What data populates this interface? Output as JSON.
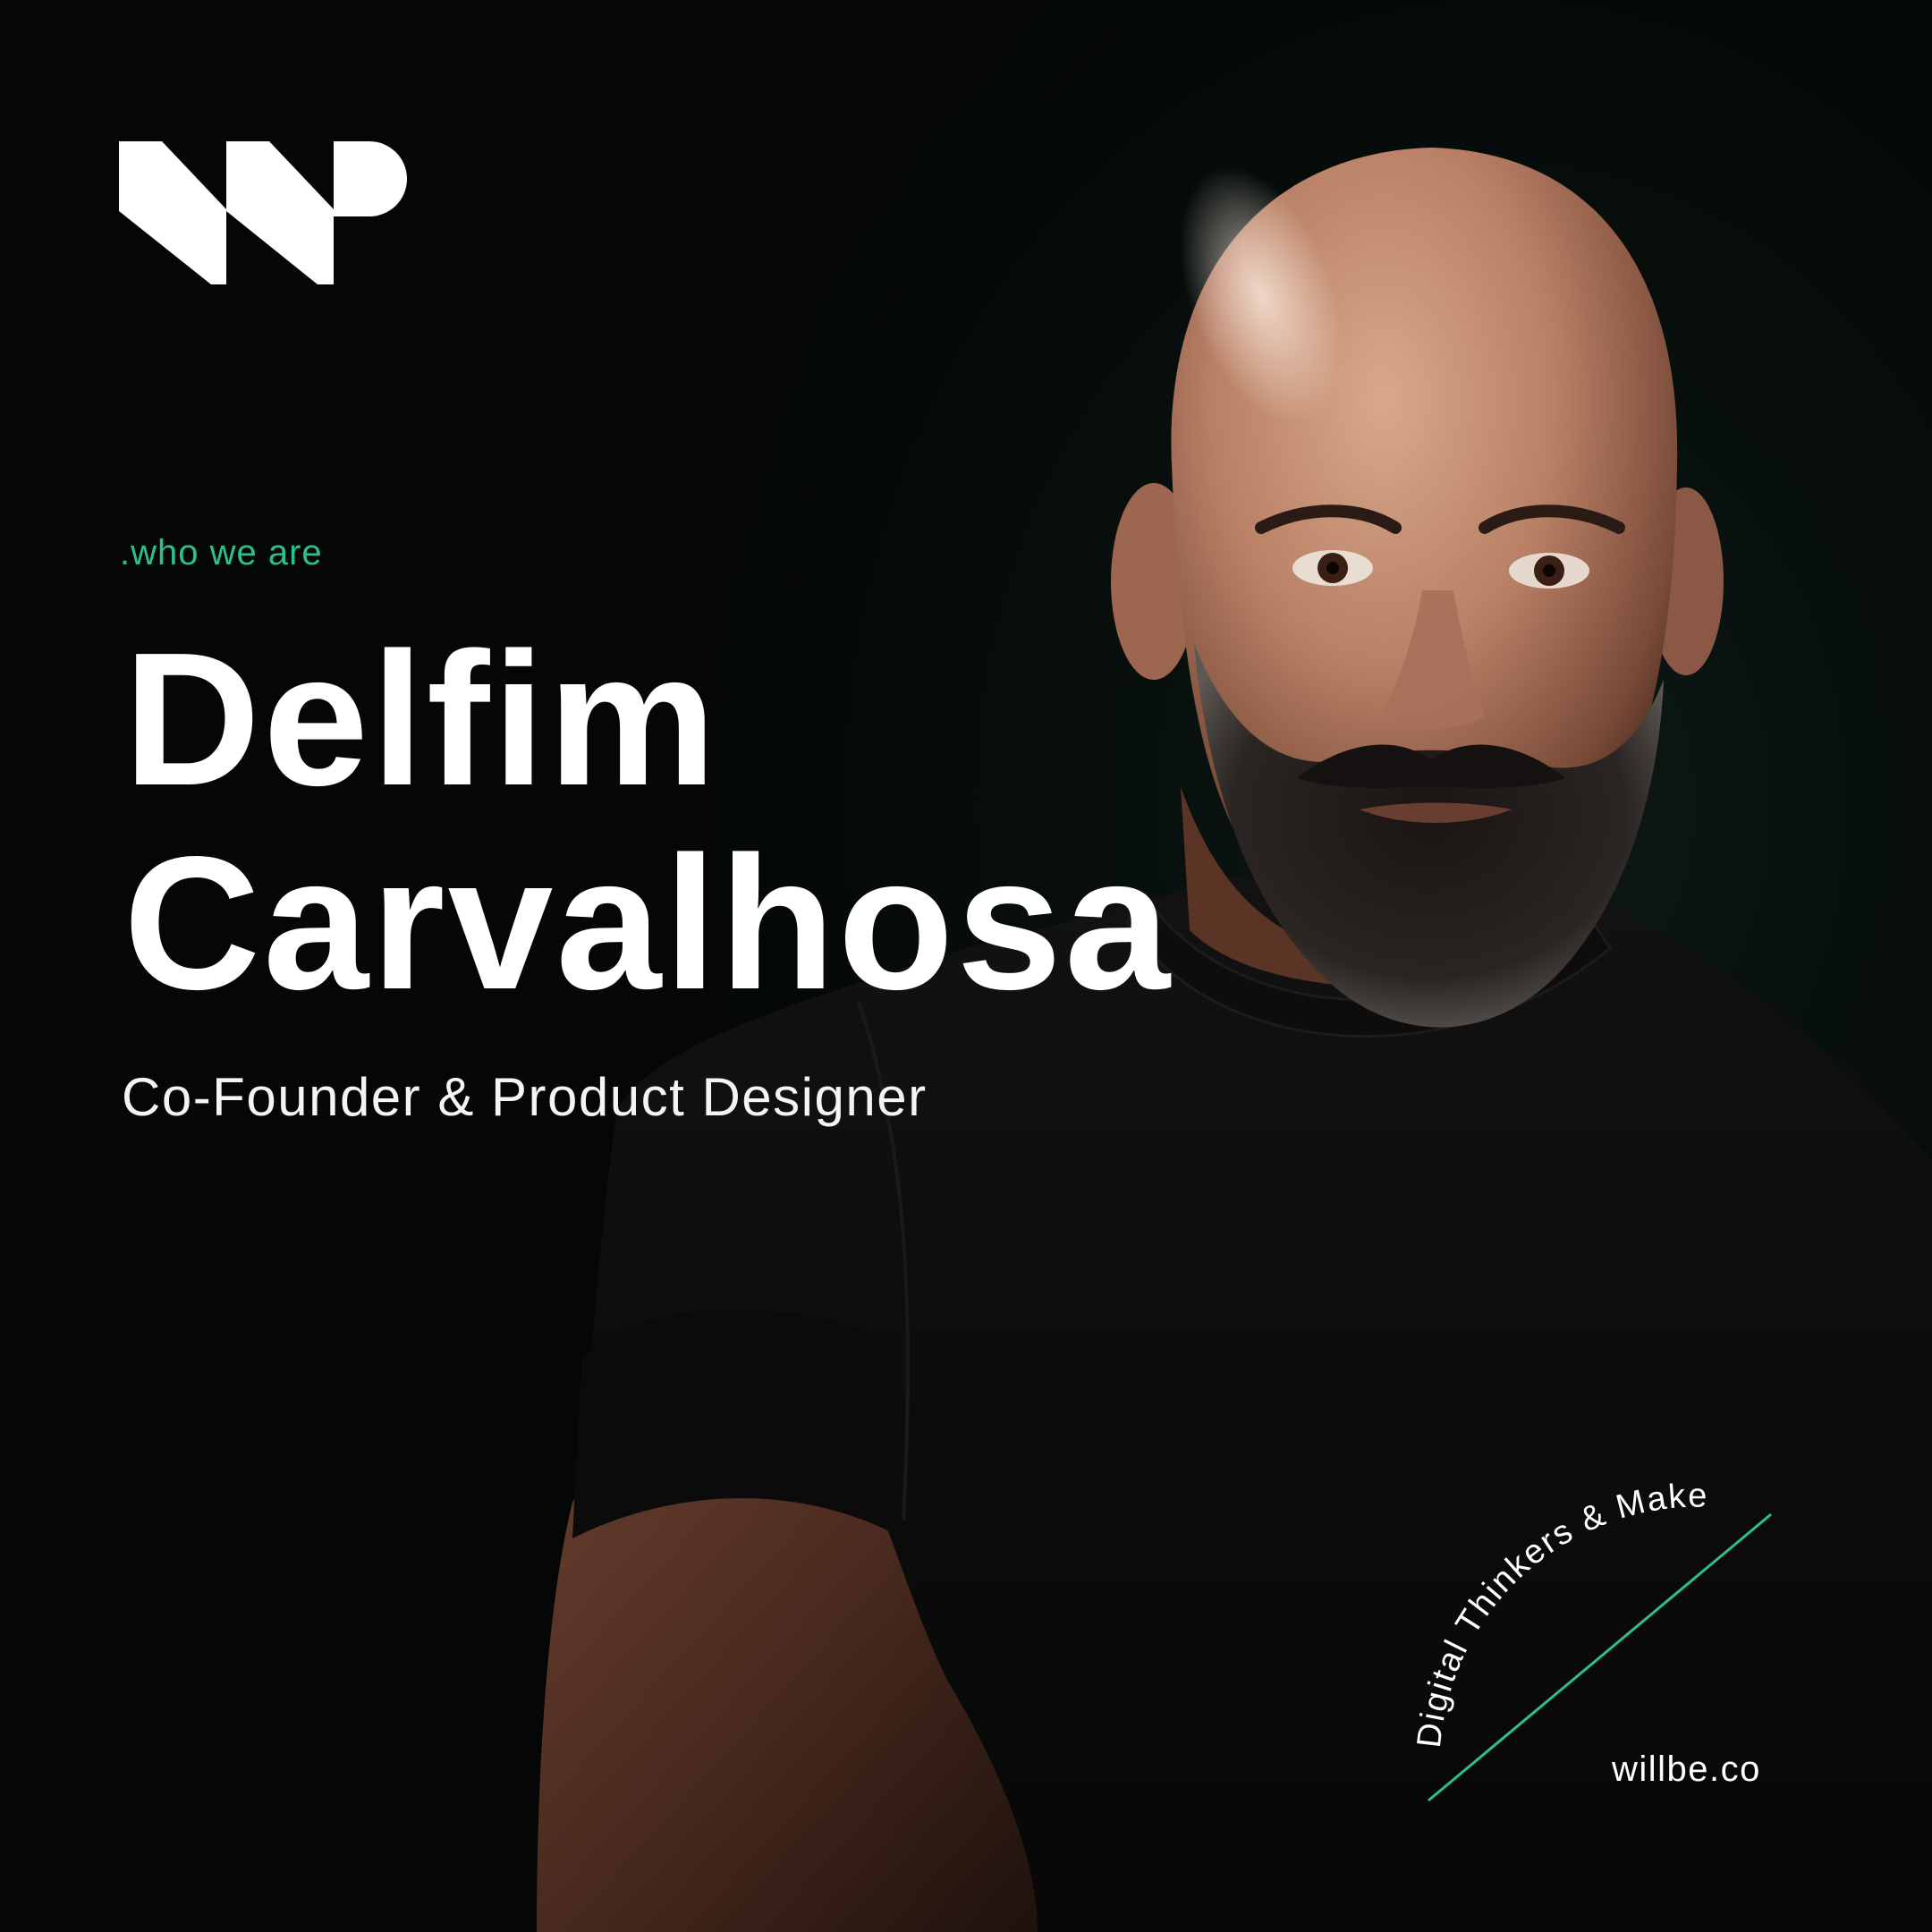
{
  "brand": {
    "logo_icon": "willbe-w-logo-icon",
    "accent_color": "#2fbf8f",
    "background_color": "#050807",
    "text_color": "#ffffff"
  },
  "eyebrow": ".who we are",
  "person": {
    "first_name": "Delfim",
    "last_name": "Carvalhosa",
    "role": "Co-Founder & Product Designer"
  },
  "badge": {
    "arc_text": "Digital Thinkers & Makers",
    "website": "willbe.co"
  }
}
